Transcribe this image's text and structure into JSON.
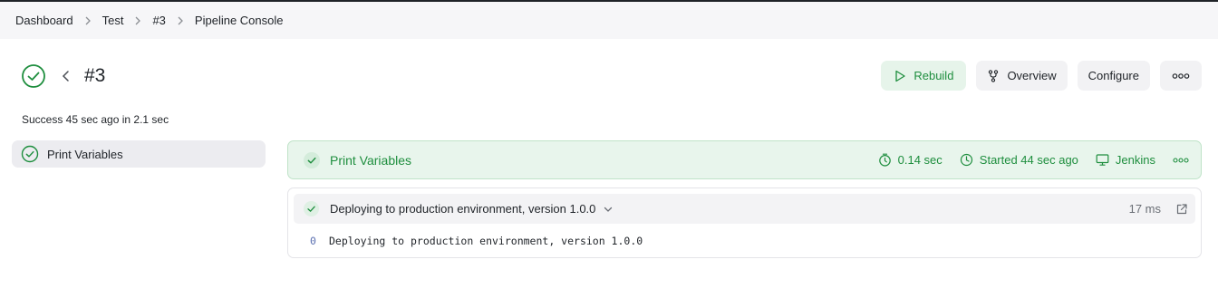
{
  "breadcrumb": [
    {
      "label": "Dashboard"
    },
    {
      "label": "Test"
    },
    {
      "label": "#3"
    },
    {
      "label": "Pipeline Console"
    }
  ],
  "header": {
    "title": "#3",
    "status_icon": "check-circle-icon",
    "summary": "Success 45 sec ago in 2.1 sec"
  },
  "actions": {
    "rebuild": "Rebuild",
    "overview": "Overview",
    "configure": "Configure"
  },
  "stages": [
    {
      "label": "Print Variables",
      "status": "success"
    }
  ],
  "selected_stage": {
    "name": "Print Variables",
    "duration": "0.14 sec",
    "started": "Started 44 sec ago",
    "agent": "Jenkins"
  },
  "steps": [
    {
      "label": "Deploying to production environment, version 1.0.0",
      "duration": "17 ms",
      "log": [
        {
          "line": "0",
          "text": "Deploying to production environment, version 1.0.0"
        }
      ]
    }
  ],
  "colors": {
    "success": "#1e8e3e",
    "success_bg": "#e8f5ec",
    "breadcrumb_bg": "#f6f6f8"
  }
}
